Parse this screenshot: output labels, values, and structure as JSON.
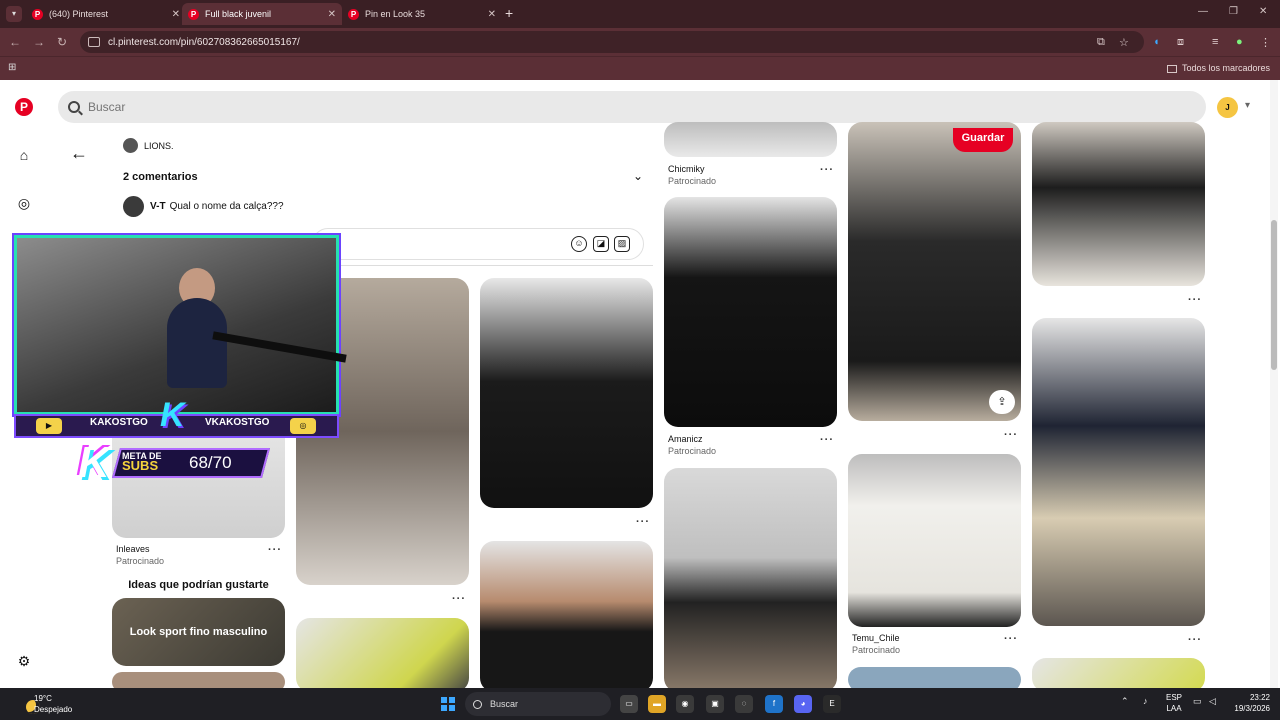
{
  "browser": {
    "tabs": [
      {
        "label": "(640) Pinterest",
        "active": false
      },
      {
        "label": "Full black juvenil",
        "active": true
      },
      {
        "label": "Pin en Look 35",
        "active": false
      }
    ],
    "url": "cl.pinterest.com/pin/602708362665015167/",
    "all_bookmarks": "Todos los marcadores"
  },
  "pinterest": {
    "search_placeholder": "Buscar",
    "avatar_initial": "J",
    "comment_panel": {
      "author": "LIONS.",
      "comments_count": "2 comentarios",
      "comment_user": "V-T",
      "comment_text": "Qual o nome da calça???"
    },
    "pins": [
      {
        "source": "Chicmiky",
        "label": "Patrocinado"
      },
      {
        "source": "Amanicz",
        "label": "Patrocinado"
      },
      {
        "source": "Inleaves",
        "label": "Patrocinado"
      },
      {
        "source": "Temu_Chile",
        "label": "Patrocinado"
      }
    ],
    "save_button": "Guardar",
    "ideas_title": "Ideas que podrían gustarte",
    "idea_card": "Look sport fino masculino"
  },
  "stream_overlay": {
    "name_left": "KAKOSTGO",
    "name_right": "VKAKOSTGO",
    "goal_label_1": "META DE",
    "goal_label_2": "SUBS",
    "goal_count": "68/70"
  },
  "taskbar": {
    "temperature": "19°C",
    "weather": "Despejado",
    "search": "Buscar",
    "lang_1": "ESP",
    "lang_2": "LAA",
    "time": "23:22",
    "date": "19/3/2026"
  }
}
